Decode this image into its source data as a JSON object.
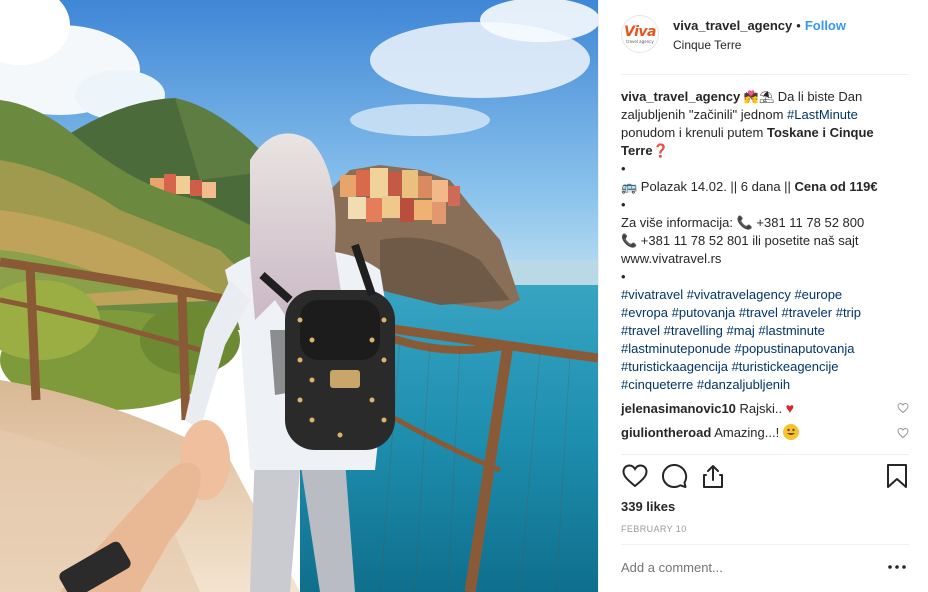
{
  "post": {
    "username": "viva_travel_agency",
    "separator": "•",
    "follow_label": "Follow",
    "location": "Cinque Terre",
    "avatar_logo": "Viva",
    "avatar_sub": "travel agency"
  },
  "caption": {
    "user": "viva_travel_agency",
    "line1": "Da li biste Dan",
    "line2a": "zaljubljenih \"začinili\" jednom ",
    "line2_tag": "#LastMinute",
    "line3a": "ponudom i krenuli putem ",
    "line3_bold": "Toskane i Cinque",
    "line4_bold": "Terre",
    "bullet": "•",
    "line6a": " Polazak 14.02. || 6 dana || ",
    "line6_bold": "Cena od 119€",
    "line8a": "Za više informacija: ",
    "phone1": " +381 11 78 52 800",
    "phone2": " +381 11 78 52 801 ili posetite naš sajt",
    "site": "www.vivatravel.rs",
    "hashtags": [
      "#vivatravel",
      "#vivatravelagency",
      "#europe",
      "#evropa",
      "#putovanja",
      "#travel",
      "#traveler",
      "#trip",
      "#travel",
      "#travelling",
      "#maj",
      "#lastminute",
      "#lastminuteponude",
      "#popustinaputovanja",
      "#turistickaagencija",
      "#turistickeagencije",
      "#cinqueterre",
      "#danzaljubljenih"
    ]
  },
  "comments": [
    {
      "user": "jelenasimanovic10",
      "text": "Rajski.."
    },
    {
      "user": "giuliontheroad",
      "text": "Amazing...!"
    }
  ],
  "likes": "339 likes",
  "date": "FEBRUARY 10",
  "add_comment_placeholder": "Add a comment...",
  "colors": {
    "link": "#003569",
    "follow": "#3897f0",
    "border": "#efefef",
    "muted": "#999999",
    "brand": "#e8541c"
  },
  "icons": [
    "heart-icon",
    "comment-icon",
    "share-icon",
    "bookmark-icon",
    "more-options-icon"
  ]
}
